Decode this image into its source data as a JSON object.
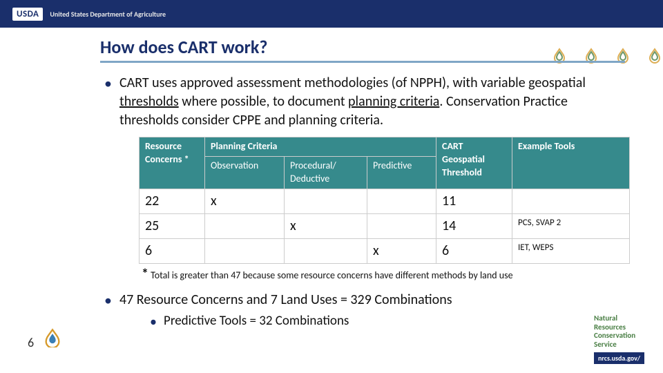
{
  "header": {
    "usda_badge": "USDA",
    "dept": "United States Department of Agriculture"
  },
  "title": "How does CART work?",
  "bullet1_pre": "CART uses approved assessment methodologies (of NPPH), with variable geospatial ",
  "bullet1_u1": "thresholds",
  "bullet1_mid": " where possible, to document ",
  "bullet1_u2": "planning criteria",
  "bullet1_post": ". Conservation Practice thresholds consider CPPE and planning criteria.",
  "table": {
    "head": {
      "rc": "Resource Concerns *",
      "pc": "Planning Criteria",
      "obs": "Observation",
      "proc": "Procedural/ Deductive",
      "pred": "Predictive",
      "geo": "CART Geospatial Threshold",
      "tools": "Example Tools"
    },
    "rows": [
      {
        "rc": "22",
        "obs": "x",
        "proc": "",
        "pred": "",
        "geo": "11",
        "tools": ""
      },
      {
        "rc": "25",
        "obs": "",
        "proc": "x",
        "pred": "",
        "geo": "14",
        "tools": "PCS, SVAP 2"
      },
      {
        "rc": "6",
        "obs": "",
        "proc": "",
        "pred": "x",
        "geo": "6",
        "tools": "IET, WEPS"
      }
    ]
  },
  "footnote_star": "*",
  "footnote_txt": " Total is greater than 47 because some resource concerns have different methods by land use",
  "bullet2": "47 Resource Concerns and 7 Land Uses = 329 Combinations",
  "bullet2_sub": "Predictive Tools = 32 Combinations",
  "page_number": "6",
  "nrcs": {
    "l1": "Natural",
    "l2": "Resources",
    "l3": "Conservation",
    "l4": "Service",
    "link": "nrcs.usda.gov/"
  }
}
